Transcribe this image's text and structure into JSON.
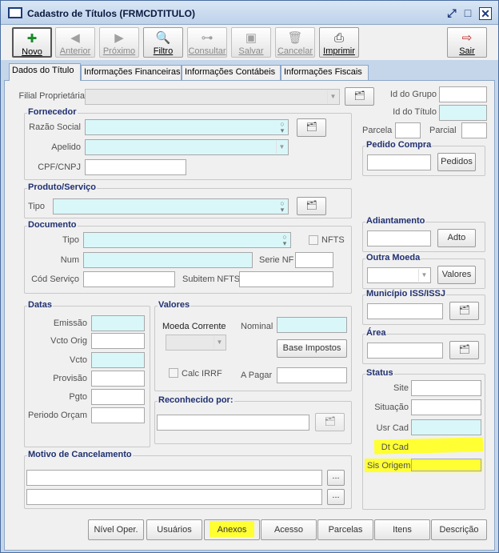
{
  "window": {
    "title": "Cadastro de Títulos  (FRMCDTITULO)"
  },
  "toolbar": {
    "novo": "Novo",
    "anterior": "Anterior",
    "proximo": "Próximo",
    "filtro": "Filtro",
    "consultar": "Consultar",
    "salvar": "Salvar",
    "cancelar": "Cancelar",
    "imprimir": "Imprimir",
    "sair": "Sair"
  },
  "tabs": [
    "Dados do Título",
    "Informações Financeiras",
    "Informações Contábeis",
    "Informações Fiscais"
  ],
  "main": {
    "filial": "Filial Proprietária",
    "id_grupo": "Id do Grupo",
    "id_titulo": "Id do Título",
    "parcela": "Parcela",
    "parcial": "Parcial"
  },
  "fornecedor": {
    "title": "Fornecedor",
    "razao": "Razão Social",
    "apelido": "Apelido",
    "cpf": "CPF/CNPJ"
  },
  "pedido": {
    "title": "Pedido Compra",
    "btn": "Pedidos"
  },
  "produto": {
    "title": "Produto/Serviço",
    "tipo": "Tipo"
  },
  "documento": {
    "title": "Documento",
    "tipo": "Tipo",
    "nfts": "NFTS",
    "num": "Num",
    "serie": "Serie NF",
    "cod": "Cód Serviço",
    "subitem": "Subitem NFTS"
  },
  "adiantamento": {
    "title": "Adiantamento",
    "btn": "Adto"
  },
  "outra": {
    "title": "Outra Moeda",
    "btn": "Valores"
  },
  "municipio": {
    "title": "Município ISS/ISSJ"
  },
  "area": {
    "title": "Área"
  },
  "datas": {
    "title": "Datas",
    "emissao": "Emissão",
    "vcto_orig": "Vcto Orig",
    "vcto": "Vcto",
    "provisao": "Provisão",
    "pgto": "Pgto",
    "periodo": "Periodo Orçam"
  },
  "valores": {
    "title": "Valores",
    "moeda": "Moeda Corrente",
    "nominal": "Nominal",
    "base": "Base Impostos",
    "calc": "Calc IRRF",
    "apagar": "A Pagar"
  },
  "reconhecido": {
    "title": "Reconhecido por:"
  },
  "status": {
    "title": "Status",
    "site": "Site",
    "situacao": "Situação",
    "usr": "Usr Cad",
    "dt": "Dt Cad",
    "sis": "Sis Origem"
  },
  "motivo": {
    "title": "Motivo de Cancelamento",
    "ellipsis": "..."
  },
  "bottom": {
    "nivel": "Nível Oper.",
    "usuarios": "Usuários",
    "anexos": "Anexos",
    "acesso": "Acesso",
    "parcelas": "Parcelas",
    "itens": "Itens",
    "descricao": "Descrição"
  },
  "highlight_color": "#ffff33"
}
